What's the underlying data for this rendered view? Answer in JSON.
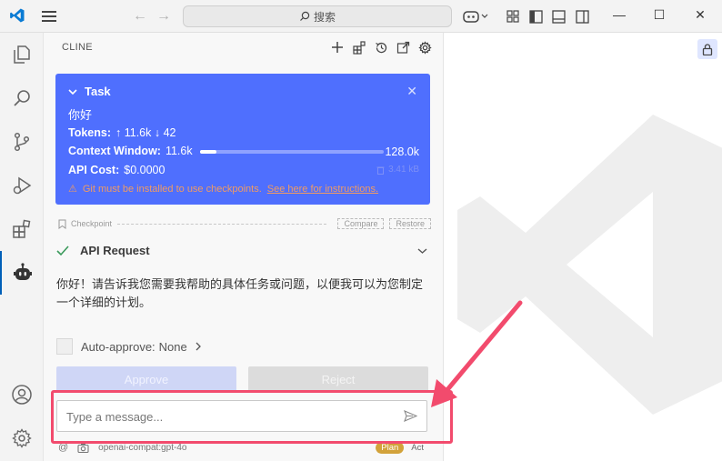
{
  "titlebar": {
    "search_label": "搜索"
  },
  "panel": {
    "title": "CLINE"
  },
  "task": {
    "label": "Task",
    "text": "你好",
    "tokens_label": "Tokens:",
    "tokens_in": "11.6k",
    "tokens_out": "42",
    "context_label": "Context Window:",
    "context_used": "11.6k",
    "context_max": "128.0k",
    "context_fraction": 0.09,
    "cost_label": "API Cost:",
    "cost_value": "$0.0000",
    "size": "3.41 kB",
    "warning_text": "Git must be installed to use checkpoints.",
    "warning_link": "See here for instructions."
  },
  "checkpoint": {
    "label": "Checkpoint",
    "compare": "Compare",
    "restore": "Restore"
  },
  "api_request": {
    "label": "API Request"
  },
  "reply": {
    "text": "你好！请告诉我您需要我帮助的具体任务或问题，以便我可以为您制定一个详细的计划。"
  },
  "auto_approve": {
    "label": "Auto-approve:",
    "value": "None"
  },
  "buttons": {
    "approve": "Approve",
    "reject": "Reject"
  },
  "input": {
    "placeholder": "Type a message..."
  },
  "footer": {
    "at": "@",
    "model": "openai-compat:gpt-4o",
    "plan": "Plan",
    "act": "Act"
  },
  "colors": {
    "task_bg": "#4f6ffe",
    "highlight": "#f24b6d",
    "plan_badge": "#d2a23a"
  }
}
